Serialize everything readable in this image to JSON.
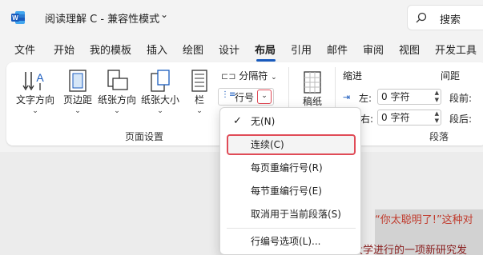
{
  "titlebar": {
    "doc_title": "阅读理解 C  -  兼容性模式",
    "caret": "⌄",
    "search_label": "搜索"
  },
  "tabs": [
    "文件",
    "开始",
    "我的模板",
    "插入",
    "绘图",
    "设计",
    "布局",
    "引用",
    "邮件",
    "审阅",
    "视图",
    "开发工具"
  ],
  "active_tab": "布局",
  "ribbon": {
    "text_direction": "文字方向",
    "margins": "页边距",
    "orientation": "纸张方向",
    "size": "纸张大小",
    "columns": "栏",
    "breaks": "分隔符",
    "line_numbers": "行号",
    "hyphenation": "稿纸",
    "page_setup_label": "页面设置",
    "indent_label": "缩进",
    "spacing_label": "间距",
    "left_label": "左:",
    "right_label": "右:",
    "left_value": "0 字符",
    "right_value": "0 字符",
    "before_label": "段前:",
    "after_label": "段后:",
    "paragraph_label": "段落"
  },
  "dropdown": {
    "items": [
      {
        "label": "无(N)",
        "checked": true
      },
      {
        "label": "连续(C)",
        "highlighted": true
      },
      {
        "label": "每页重编行号(R)"
      },
      {
        "label": "每节重编行号(E)"
      },
      {
        "label": "取消用于当前段落(S)"
      },
      {
        "label": "行编号选项(L)..."
      }
    ],
    "check_glyph": "✓"
  },
  "document": {
    "line1": "“你太聪明了!”这种对",
    "line2": "大学进行的一项新研究发"
  },
  "colors": {
    "accent": "#185abd",
    "highlight_border": "#e04b57",
    "doc_text": "#c0392b"
  }
}
